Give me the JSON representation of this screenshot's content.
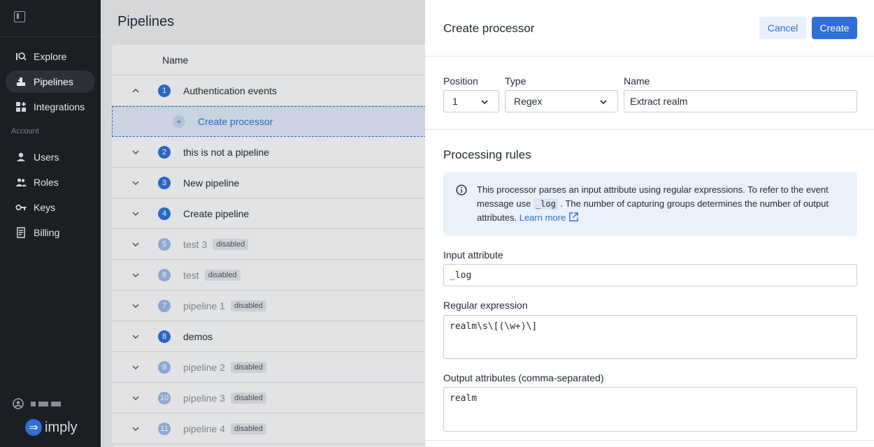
{
  "sidebar": {
    "nav": [
      {
        "label": "Explore",
        "icon": "explore-icon"
      },
      {
        "label": "Pipelines",
        "icon": "pipelines-icon"
      },
      {
        "label": "Integrations",
        "icon": "integrations-icon"
      }
    ],
    "section_label": "Account",
    "account": [
      {
        "label": "Users",
        "icon": "users-icon"
      },
      {
        "label": "Roles",
        "icon": "roles-icon"
      },
      {
        "label": "Keys",
        "icon": "keys-icon"
      },
      {
        "label": "Billing",
        "icon": "billing-icon"
      }
    ],
    "logo_text": "imply"
  },
  "main": {
    "title": "Pipelines",
    "column_name": "Name",
    "create_processor_label": "Create processor",
    "rows": [
      {
        "num": "1",
        "name": "Authentication events",
        "disabled": false
      },
      {
        "num": "2",
        "name": "this is not a pipeline",
        "disabled": false
      },
      {
        "num": "3",
        "name": "New pipeline",
        "disabled": false
      },
      {
        "num": "4",
        "name": "Create pipeline",
        "disabled": false
      },
      {
        "num": "5",
        "name": "test 3",
        "disabled": true
      },
      {
        "num": "6",
        "name": "test",
        "disabled": true
      },
      {
        "num": "7",
        "name": "pipeline 1",
        "disabled": true
      },
      {
        "num": "8",
        "name": "demos",
        "disabled": false
      },
      {
        "num": "9",
        "name": "pipeline 2",
        "disabled": true
      },
      {
        "num": "10",
        "name": "pipeline 3",
        "disabled": true
      },
      {
        "num": "11",
        "name": "pipeline 4",
        "disabled": true
      }
    ],
    "disabled_badge": "disabled"
  },
  "panel": {
    "title": "Create processor",
    "cancel_label": "Cancel",
    "create_label": "Create",
    "position_label": "Position",
    "position_value": "1",
    "type_label": "Type",
    "type_value": "Regex",
    "name_label": "Name",
    "name_value": "Extract realm",
    "section_title": "Processing rules",
    "info_text_1": "This processor parses an input attribute using regular expressions. To refer to the event message use",
    "info_code": "_log",
    "info_text_2": ". The number of capturing groups determines the number of output attributes.",
    "info_link": "Learn more",
    "input_attr_label": "Input attribute",
    "input_attr_value": "_log",
    "regex_label": "Regular expression",
    "regex_value": "realm\\s\\[(\\w+)\\]",
    "output_label": "Output attributes (comma-separated)",
    "output_value": "realm"
  },
  "colors": {
    "accent": "#2f6fd6",
    "sidebar_bg": "#1b1e23"
  }
}
